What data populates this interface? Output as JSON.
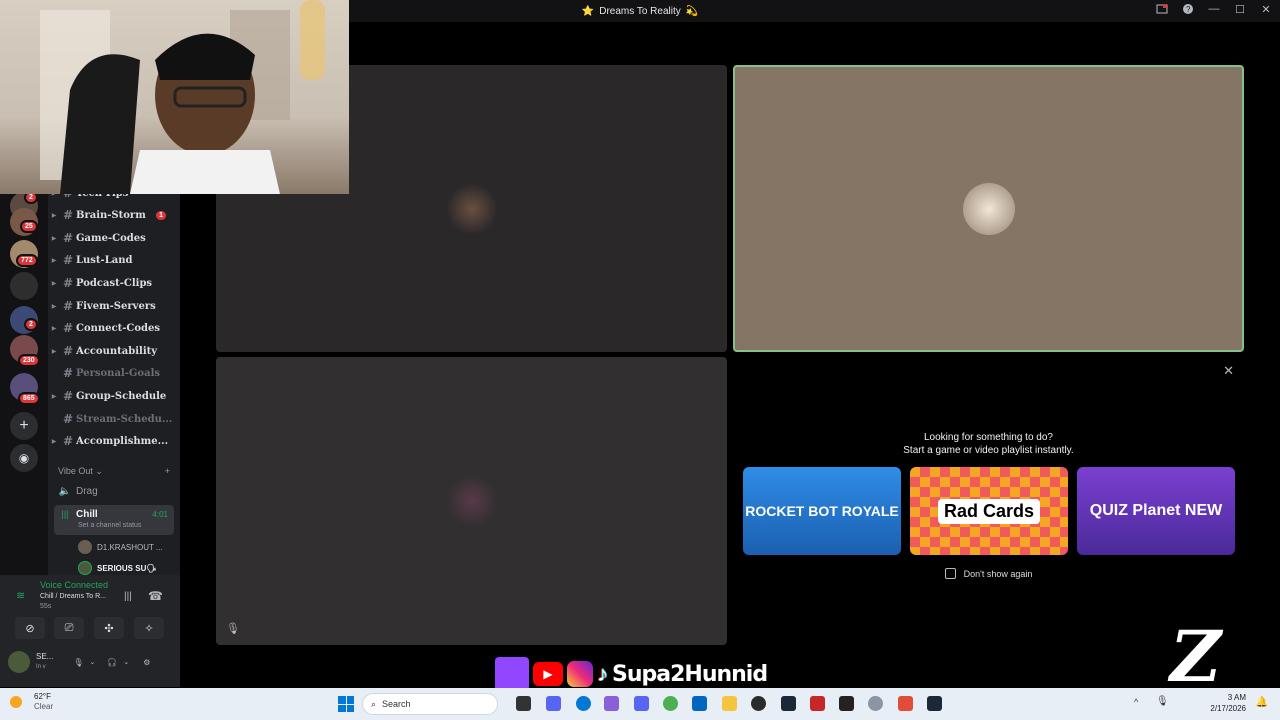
{
  "window": {
    "title": "Dreams To Reality",
    "title_icon": "⭐",
    "title_suffix": "💫"
  },
  "servers": {
    "badges": [
      "2",
      "25",
      "772",
      "2",
      "230",
      "865"
    ]
  },
  "channels": [
    {
      "name": "Tech-Tips",
      "muted": false,
      "unread": ""
    },
    {
      "name": "Brain-Storm",
      "muted": false,
      "unread": "1"
    },
    {
      "name": "Game-Codes",
      "muted": false,
      "unread": ""
    },
    {
      "name": "Lust-Land",
      "muted": false,
      "unread": ""
    },
    {
      "name": "Podcast-Clips",
      "muted": false,
      "unread": ""
    },
    {
      "name": "Fivem-Servers",
      "muted": false,
      "unread": ""
    },
    {
      "name": "Connect-Codes",
      "muted": false,
      "unread": ""
    },
    {
      "name": "Accountability",
      "muted": false,
      "unread": ""
    },
    {
      "name": "Personal-Goals",
      "muted": true,
      "unread": ""
    },
    {
      "name": "Group-Schedule",
      "muted": false,
      "unread": ""
    },
    {
      "name": "Stream-Schedu...",
      "muted": true,
      "unread": ""
    },
    {
      "name": "Accomplishme...",
      "muted": false,
      "unread": ""
    }
  ],
  "voice": {
    "category": "Vibe Out",
    "channels": [
      {
        "name": "Drag",
        "time": ""
      },
      {
        "name": "Chill",
        "time": "4:01",
        "status": "Set a channel status"
      }
    ],
    "users": [
      "D1.KRASHOUT ...",
      "SERIOUS SU🗣"
    ]
  },
  "panel": {
    "status": "Voice Connected",
    "channel": "Chill / Dreams To R...",
    "duration": "55s",
    "user": "SE...",
    "user_status": "In v"
  },
  "activity": {
    "heading": "Looking for something to do?",
    "subheading": "Start a game or video playlist instantly.",
    "games": [
      "ROCKET BOT ROYALE",
      "Rad Cards",
      "QUIZ Planet NEW"
    ],
    "dont_show": "Don't show again"
  },
  "taskbar": {
    "temp": "62°F",
    "weather": "Clear",
    "search_placeholder": "Search",
    "time": "3 AM",
    "date": "2/17/2026"
  },
  "overlay": {
    "handle": "Supa2Hunnid"
  },
  "colors": {
    "active_border": "#86c08a",
    "tile_dark": "#2b2829",
    "tile_brown": "#857564",
    "tile_grey": "#312f30"
  }
}
